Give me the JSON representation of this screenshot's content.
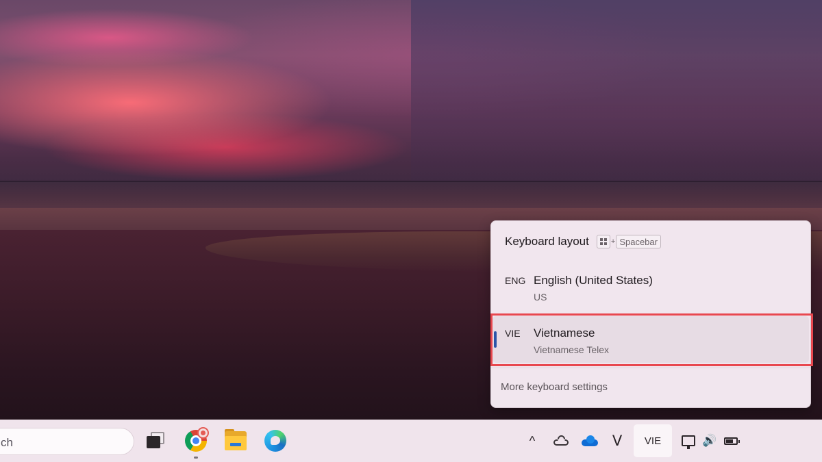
{
  "keyboard_flyout": {
    "title": "Keyboard layout",
    "shortcut": {
      "plus": "+",
      "key": "Spacebar"
    },
    "layouts": [
      {
        "code": "ENG",
        "name": "English (United States)",
        "subtitle": "US",
        "selected": false
      },
      {
        "code": "VIE",
        "name": "Vietnamese",
        "subtitle": "Vietnamese Telex",
        "selected": true
      }
    ],
    "more_settings_label": "More keyboard settings"
  },
  "taskbar": {
    "search_text": "ch",
    "pinned_apps": [
      {
        "name": "Task View",
        "icon": "task-view-icon"
      },
      {
        "name": "Google Chrome",
        "icon": "chrome-icon",
        "running": true,
        "badge": true
      },
      {
        "name": "File Explorer",
        "icon": "folder-icon"
      },
      {
        "name": "Microsoft Edge",
        "icon": "edge-icon"
      }
    ],
    "tray": {
      "chevron_glyph": "^",
      "v_glyph": "V",
      "input_indicator": "VIE",
      "speaker_glyph": "🔊"
    }
  },
  "colors": {
    "highlight_box": "#e8484f",
    "selection_indicator": "#2a56a8",
    "flyout_background": "#f1e6ee",
    "taskbar_background": "#f0e4ec"
  }
}
